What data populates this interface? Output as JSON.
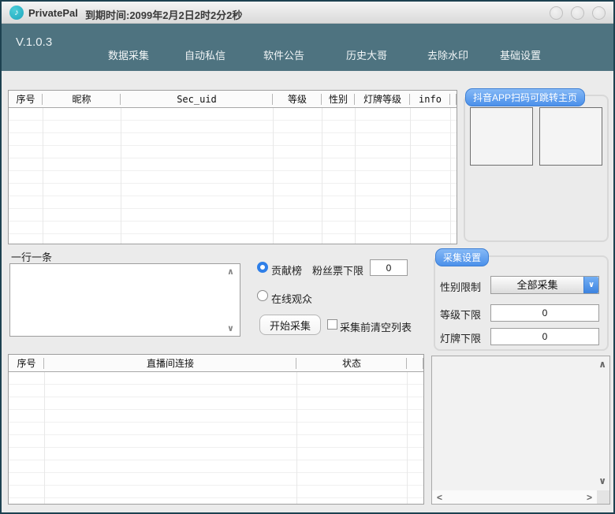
{
  "window": {
    "title": "PrivatePal",
    "expiry_text": "到期时间:2099年2月2日2时2分2秒"
  },
  "navbar": {
    "version": "V.1.0.3",
    "items": [
      {
        "label": "数据采集"
      },
      {
        "label": "自动私信"
      },
      {
        "label": "软件公告"
      },
      {
        "label": "历史大哥"
      },
      {
        "label": "去除水印"
      },
      {
        "label": "基础设置"
      }
    ]
  },
  "user_table": {
    "columns": [
      "序号",
      "昵称",
      "Sec_uid",
      "等级",
      "性别",
      "灯牌等级",
      "info"
    ],
    "rows": []
  },
  "qr_panel": {
    "label": "抖音APP扫码可跳转主页"
  },
  "collect": {
    "lines_hint": "一行一条",
    "list_value": "",
    "mode_contribution": "贡献榜",
    "mode_online": "在线观众",
    "mode_selected": "贡献榜",
    "fan_ticket_label": "粉丝票下限",
    "fan_ticket_value": "0",
    "start_button": "开始采集",
    "clear_before_label": "采集前清空列表",
    "clear_before_checked": false
  },
  "settings": {
    "label": "采集设置",
    "gender_label": "性别限制",
    "gender_value": "全部采集",
    "level_label": "等级下限",
    "level_value": "0",
    "badge_label": "灯牌下限",
    "badge_value": "0"
  },
  "room_table": {
    "columns": [
      "序号",
      "直播间连接",
      "状态"
    ],
    "rows": []
  },
  "icons": {
    "logo_note": "♪",
    "scroll_up": "∧",
    "scroll_down": "∨",
    "scroll_left": "<",
    "scroll_right": ">",
    "dropdown_chevron": "∨"
  },
  "colors": {
    "navbar": "#4e7380",
    "accent_blue": "#4b90ea",
    "logo_teal": "#2cb5c8",
    "radio_selected": "#2f7fe8",
    "window_border": "#1d4150"
  }
}
